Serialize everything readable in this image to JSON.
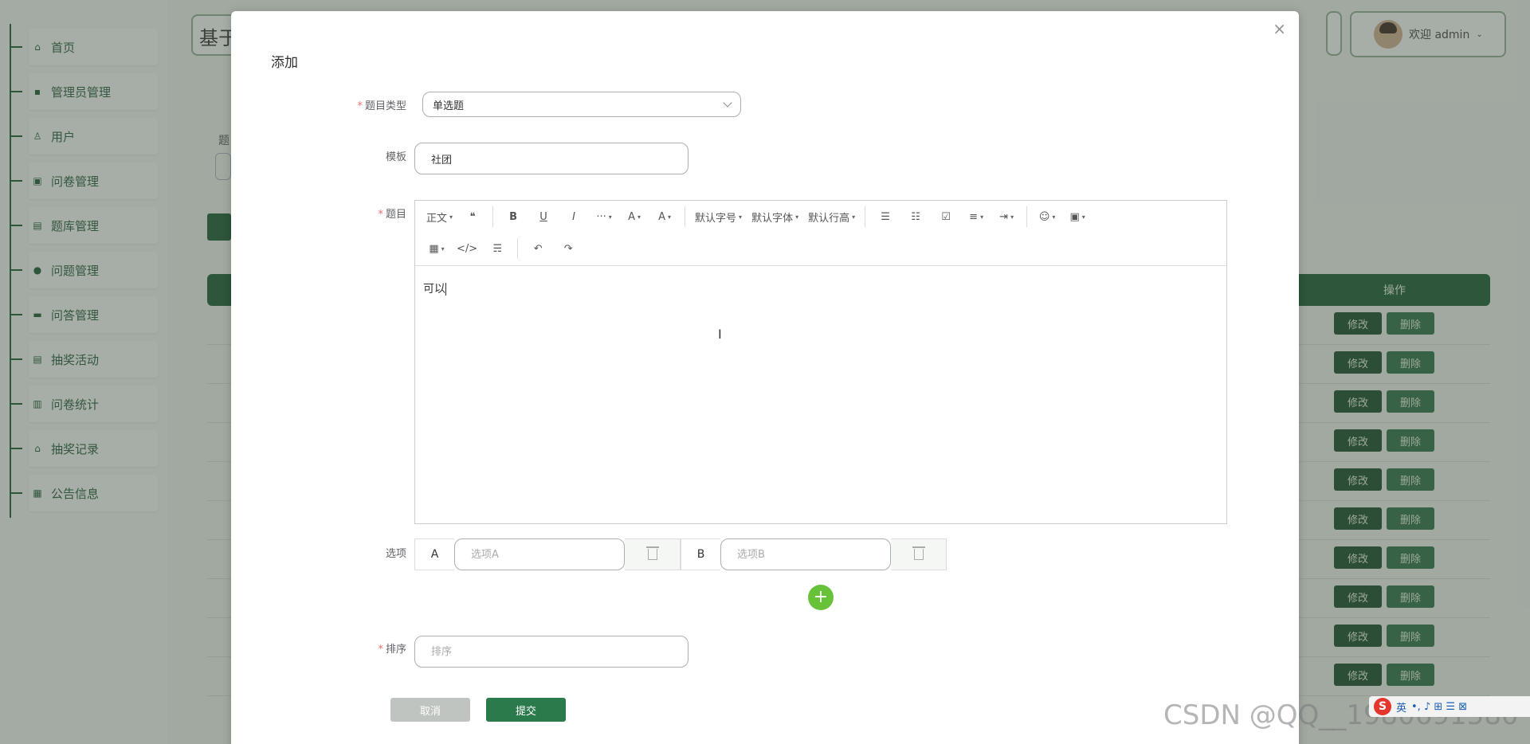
{
  "sidebar": {
    "items": [
      {
        "label": "首页",
        "icon": "home-icon"
      },
      {
        "label": "管理员管理",
        "icon": "admin-icon"
      },
      {
        "label": "用户",
        "icon": "user-icon"
      },
      {
        "label": "问卷管理",
        "icon": "survey-icon"
      },
      {
        "label": "题库管理",
        "icon": "question-bank-icon"
      },
      {
        "label": "问题管理",
        "icon": "question-icon"
      },
      {
        "label": "问答管理",
        "icon": "qa-icon"
      },
      {
        "label": "抽奖活动",
        "icon": "lottery-icon"
      },
      {
        "label": "问卷统计",
        "icon": "stats-icon"
      },
      {
        "label": "抽奖记录",
        "icon": "gift-icon"
      },
      {
        "label": "公告信息",
        "icon": "notice-icon"
      }
    ]
  },
  "header": {
    "app_title": "基于",
    "user_greeting": "欢迎 admin"
  },
  "background_page": {
    "filter_label": "题",
    "table_header_action": "操作",
    "row_count": 10,
    "edit_label": "修改",
    "delete_label": "删除"
  },
  "dialog": {
    "title": "添加",
    "close": "×",
    "type_label": "题目类型",
    "type_value": "单选题",
    "template_label": "模板",
    "template_value": "社团",
    "question_label": "题目",
    "editor": {
      "toolbar_row1": [
        "正文",
        "❝",
        "B",
        "U",
        "I",
        "···",
        "A",
        "A",
        "默认字号",
        "默认字体",
        "默认行高",
        "☰",
        "☷",
        "☑",
        "≡",
        "⇥",
        "☺",
        "▣"
      ],
      "toolbar_row2": [
        "▦",
        "</>",
        "☴",
        "↶",
        "↷"
      ],
      "content": "可以"
    },
    "options_label": "选项",
    "options": [
      {
        "letter": "A",
        "placeholder": "选项A"
      },
      {
        "letter": "B",
        "placeholder": "选项B"
      }
    ],
    "add_option": "+",
    "sort_label": "排序",
    "sort_placeholder": "排序",
    "cancel_label": "取消",
    "submit_label": "提交"
  },
  "watermark": "CSDN @QQ__1980691580",
  "ime": {
    "logo": "S",
    "lang": "英"
  }
}
